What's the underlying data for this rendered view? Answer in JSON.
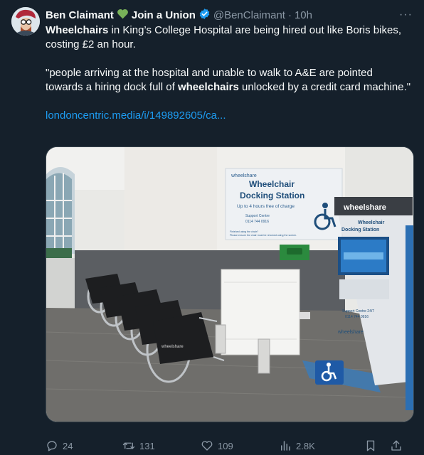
{
  "author": {
    "display_name": "Ben Claimant",
    "heart_emoji": "💚",
    "union_text": "Join a Union",
    "handle": "@BenClaimant",
    "separator": "·",
    "time": "10h"
  },
  "more_glyph": "···",
  "tweet": {
    "line1_bold": "Wheelchairs",
    "line1_rest": " in King’s College Hospital are being hired out like Boris bikes, costing £2 an hour.",
    "quote_pre": "\"people arriving at the hospital and unable to walk to A&E are pointed towards a hiring dock full of ",
    "quote_bold": "wheelchairs",
    "quote_post": " unlocked by a credit card machine.\"",
    "link": "londoncentric.media/i/149892605/ca..."
  },
  "media": {
    "poster_brand": "wheelshare",
    "poster_title_1": "Wheelchair",
    "poster_title_2": "Docking Station",
    "poster_sub": "Up to 4 hours free of charge",
    "poster_support": "Support Centre",
    "poster_phone": "0114 744 0916",
    "poster_footer_1": "Finished using the chair?",
    "poster_footer_2": "Please ensure the chair must be returned using the screen.",
    "kiosk_brand": "wheelshare",
    "kiosk_title_1": "Wheelchair",
    "kiosk_title_2": "Docking Station",
    "kiosk_support_1": "Support Centre 24/7",
    "kiosk_support_2": "0114 744 0916",
    "kiosk_brand_small": "wheelshare",
    "chair_brand": "wheelshare"
  },
  "actions": {
    "replies": "24",
    "reposts": "131",
    "likes": "109",
    "views": "2.8K"
  },
  "colors": {
    "background": "#15202b",
    "muted": "#8b98a5",
    "link": "#1d9bf0",
    "verified": "#1d9bf0",
    "heart": "#78b159"
  }
}
